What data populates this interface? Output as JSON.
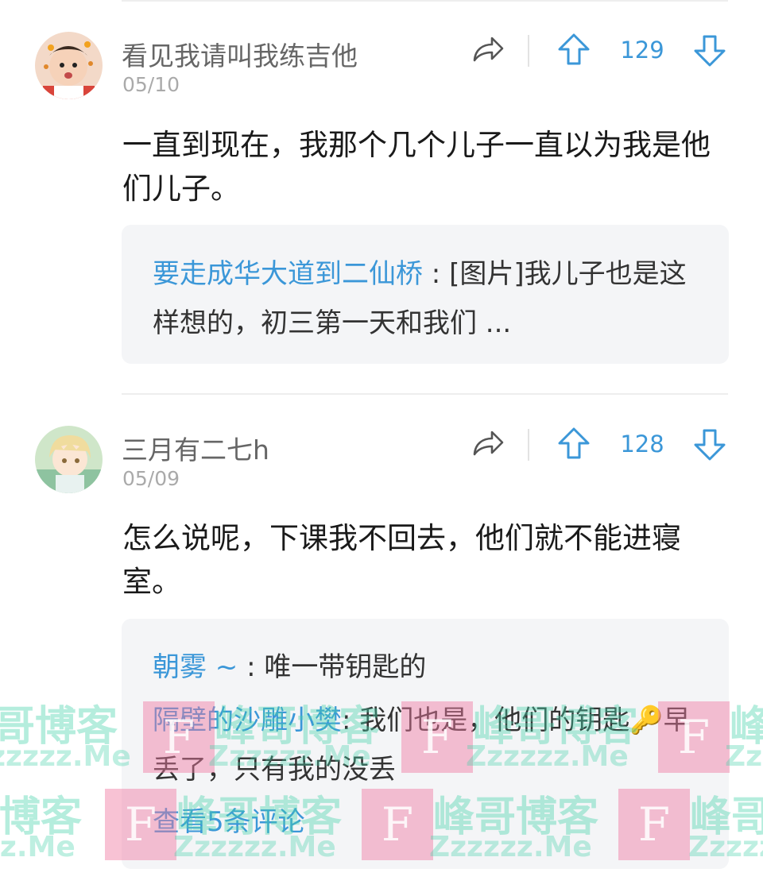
{
  "comments": [
    {
      "username": "看见我请叫我练吉他",
      "date": "05/10",
      "votes": "129",
      "text": "一直到现在，我那个几个儿子一直以为我是他们儿子。",
      "replies": [
        {
          "name": "要走成华大道到二仙桥",
          "sep": " : ",
          "text": "[图片]我儿子也是这样想的，初三第一天和我们 ..."
        }
      ]
    },
    {
      "username": "三月有二七h",
      "date": "05/09",
      "votes": "128",
      "text": "怎么说呢，下课我不回去，他们就不能进寝室。",
      "replies": [
        {
          "name": "朝雾 ~",
          "sep": " : ",
          "text": "唯一带钥匙的"
        },
        {
          "name": "隔壁的沙雕小樊",
          "sep": ": ",
          "text_before": "我们也是，他们的钥匙",
          "emoji": "🔑",
          "text_after": "早丢了，只有我的没丢"
        }
      ],
      "view_more": "查看5条评论"
    }
  ],
  "icons": {
    "share": "share-icon",
    "upvote": "arrow-up-icon",
    "downvote": "arrow-down-icon"
  },
  "watermark": {
    "brand_cn": "峰哥博客",
    "brand_en": "Zzzzzz.Me",
    "logo_letter": "F"
  },
  "colors": {
    "accent": "#3b97d8",
    "username": "#666666",
    "reply_bg": "#f4f5f7"
  }
}
